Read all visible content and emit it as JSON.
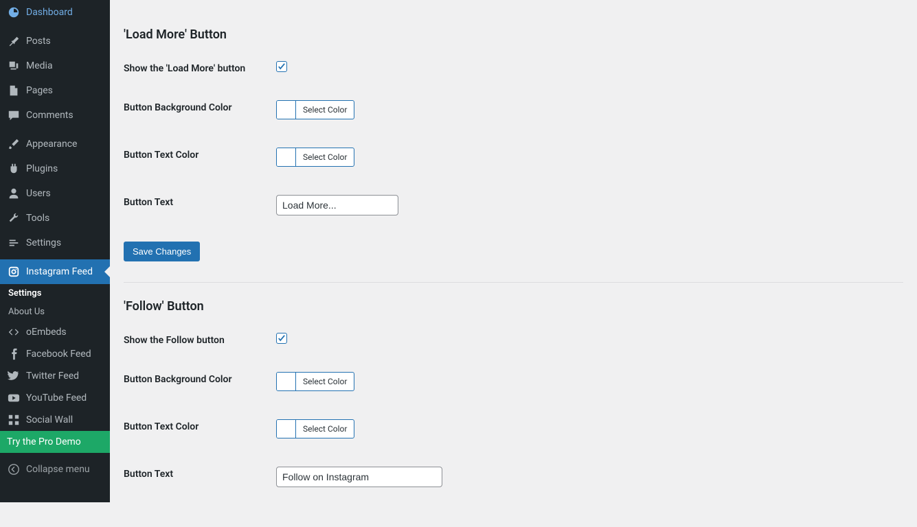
{
  "sidebar": {
    "dashboard": "Dashboard",
    "posts": "Posts",
    "media": "Media",
    "pages": "Pages",
    "comments": "Comments",
    "appearance": "Appearance",
    "plugins": "Plugins",
    "users": "Users",
    "tools": "Tools",
    "settings": "Settings",
    "instagram_feed": "Instagram Feed",
    "submenu": {
      "settings": "Settings",
      "about_us": "About Us",
      "oembeds": "oEmbeds",
      "facebook_feed": "Facebook Feed",
      "twitter_feed": "Twitter Feed",
      "youtube_feed": "YouTube Feed",
      "social_wall": "Social Wall"
    },
    "try_pro": "Try the Pro Demo",
    "collapse": "Collapse menu"
  },
  "loadmore": {
    "title": "'Load More' Button",
    "show_label": "Show the 'Load More' button",
    "bg_label": "Button Background Color",
    "text_color_label": "Button Text Color",
    "button_text_label": "Button Text",
    "button_text_value": "Load More...",
    "select_color": "Select Color",
    "save": "Save Changes"
  },
  "follow": {
    "title": "'Follow' Button",
    "show_label": "Show the Follow button",
    "bg_label": "Button Background Color",
    "text_color_label": "Button Text Color",
    "button_text_label": "Button Text",
    "button_text_value": "Follow on Instagram",
    "select_color": "Select Color"
  }
}
